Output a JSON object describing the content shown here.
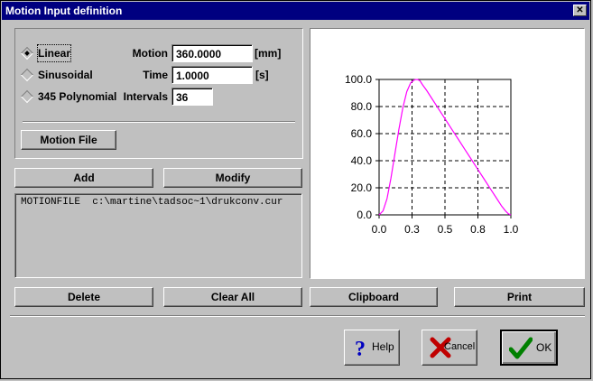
{
  "window": {
    "title": "Motion Input definition"
  },
  "motion_type": {
    "options": [
      {
        "label": "Linear",
        "selected": true
      },
      {
        "label": "Sinusoidal",
        "selected": false
      },
      {
        "label": "345 Polynomial",
        "selected": false
      }
    ]
  },
  "fields": {
    "motion": {
      "label": "Motion",
      "value": "360.0000",
      "unit": "[mm]"
    },
    "time": {
      "label": "Time",
      "value": "1.0000",
      "unit": "[s]"
    },
    "intervals": {
      "label": "Intervals",
      "value": "36"
    }
  },
  "buttons": {
    "motion_file": "Motion File",
    "add": "Add",
    "modify": "Modify",
    "delete": "Delete",
    "clear_all": "Clear All",
    "clipboard": "Clipboard",
    "print": "Print",
    "help": "Help",
    "cancel": "Cancel",
    "ok": "OK"
  },
  "list": {
    "items": [
      "MOTIONFILE  c:\\martine\\tadsoc~1\\drukconv.cur"
    ]
  },
  "chart_data": {
    "type": "line",
    "x_ticks": [
      "0.0",
      "0.3",
      "0.5",
      "0.8",
      "1.0"
    ],
    "y_ticks": [
      "0.0",
      "20.0",
      "40.0",
      "60.0",
      "80.0",
      "100.0"
    ],
    "xlim": [
      0,
      1.0
    ],
    "ylim": [
      0,
      100
    ],
    "grid": true,
    "series": [
      {
        "color": "#ff00ff",
        "x": [
          0.0,
          0.03,
          0.06,
          0.09,
          0.12,
          0.15,
          0.18,
          0.21,
          0.24,
          0.27,
          0.29,
          0.31,
          0.33,
          0.36,
          0.4,
          0.45,
          0.5,
          0.55,
          0.6,
          0.65,
          0.7,
          0.75,
          0.8,
          0.85,
          0.9,
          0.93,
          0.96,
          0.98,
          1.0
        ],
        "y": [
          0.0,
          3.0,
          12.0,
          27.0,
          45.0,
          63.0,
          79.0,
          91.0,
          97.5,
          99.8,
          100.0,
          99.0,
          96.0,
          92.0,
          86.0,
          78.5,
          71.0,
          63.5,
          56.0,
          48.5,
          41.0,
          33.5,
          26.0,
          18.5,
          11.0,
          6.5,
          2.8,
          0.9,
          0.0
        ]
      }
    ]
  }
}
